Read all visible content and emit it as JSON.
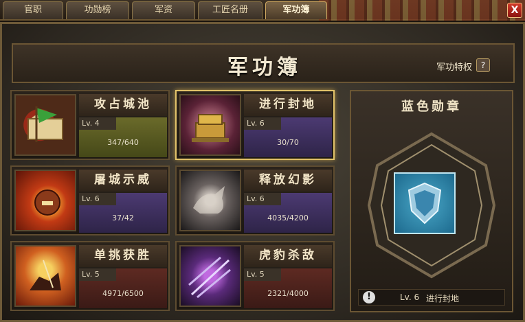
{
  "tabs": [
    {
      "label": "官职"
    },
    {
      "label": "功勋榜"
    },
    {
      "label": "军资"
    },
    {
      "label": "工匠名册"
    },
    {
      "label": "军功簿",
      "active": true
    }
  ],
  "close_label": "X",
  "header": {
    "title": "军功簿",
    "privilege_label": "军功特权",
    "help_label": "?"
  },
  "cards": [
    {
      "name": "攻占城池",
      "level": "Lv. 4",
      "progress": "347/640",
      "icon": "scroll-flag-icon",
      "color": "#6a6a2a"
    },
    {
      "name": "进行封地",
      "level": "Lv. 6",
      "progress": "30/70",
      "icon": "treasure-chest-icon",
      "color": "#4c3a72",
      "selected": true
    },
    {
      "name": "屠城示威",
      "level": "Lv. 6",
      "progress": "37/42",
      "icon": "warrior-face-icon",
      "color": "#4c3a72"
    },
    {
      "name": "释放幻影",
      "level": "Lv. 6",
      "progress": "4035/4200",
      "icon": "phantom-horse-icon",
      "color": "#4c3a72"
    },
    {
      "name": "单挑获胜",
      "level": "Lv. 5",
      "progress": "4971/6500",
      "icon": "duel-horse-icon",
      "color": "#5e2a22"
    },
    {
      "name": "虎豹杀敌",
      "level": "Lv. 5",
      "progress": "2321/4000",
      "icon": "spears-icon",
      "color": "#5e2a22"
    }
  ],
  "medal": {
    "title": "蓝色勋章",
    "icon": "blue-shield-medal-icon",
    "footer_level": "Lv. 6",
    "footer_name": "进行封地",
    "alert_icon": "exclamation-icon"
  }
}
